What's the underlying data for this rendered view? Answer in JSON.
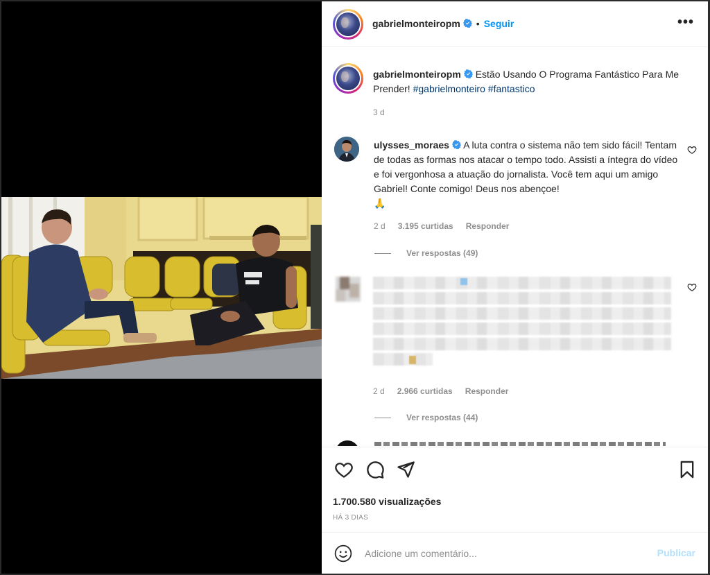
{
  "post": {
    "author": "gabrielmonteiropm",
    "follow_label": "Seguir",
    "dot": "•",
    "more_label": "•••"
  },
  "caption": {
    "author": "gabrielmonteiropm",
    "text": "Estão Usando O Programa Fantástico Para Me Prender!",
    "tag1": "#gabrielmonteiro",
    "tag2": "#fantastico",
    "time": "3 d"
  },
  "comments": [
    {
      "author": "ulysses_moraes",
      "text": "A luta contra o sistema não tem sido fácil! Tentam de todas as formas nos atacar o tempo todo. Assisti a íntegra do vídeo e foi vergonhosa a atuação do jornalista. Você tem aqui um amigo Gabriel! Conte comigo! Deus nos abençoe!",
      "emoji": "🙏",
      "time": "2 d",
      "likes": "3.195 curtidas",
      "reply_label": "Responder",
      "view_replies": "Ver respostas (49)"
    },
    {
      "author": "",
      "text": "",
      "time": "2 d",
      "likes": "2.966 curtidas",
      "reply_label": "Responder",
      "view_replies": "Ver respostas (44)"
    }
  ],
  "stats": {
    "views": "1.700.580 visualizações",
    "posted": "HÁ 3 DIAS"
  },
  "composer": {
    "placeholder": "Adicione um comentário...",
    "publish_label": "Publicar"
  },
  "colors": {
    "accent": "#0095f6",
    "verified": "#3897f0",
    "hashtag": "#00376b",
    "publish_disabled": "#b2dffc"
  }
}
